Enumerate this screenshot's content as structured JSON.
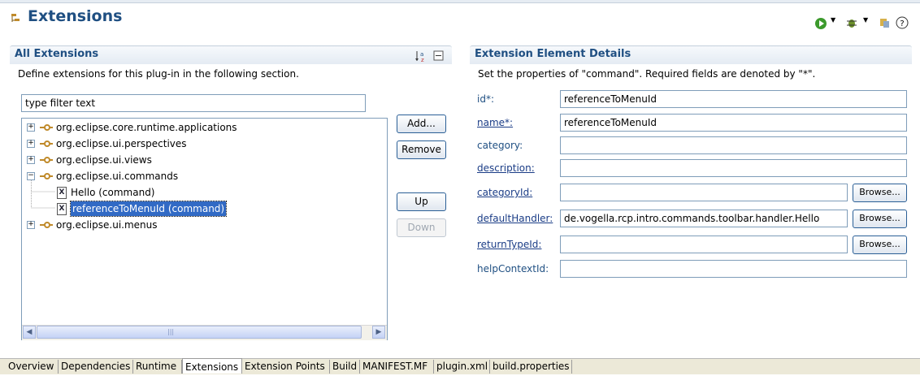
{
  "editor": {
    "title": "Extensions"
  },
  "toolbar_icons": [
    "run-icon",
    "dropdown-arrow-icon",
    "debug-icon",
    "dropdown-arrow-icon",
    "export-icon",
    "help-icon"
  ],
  "left": {
    "title": "All Extensions",
    "description": "Define extensions for this plug-in in the following section.",
    "filter_placeholder": "type filter text",
    "tree": [
      {
        "label": "org.eclipse.core.runtime.applications",
        "expanded": false
      },
      {
        "label": "org.eclipse.ui.perspectives",
        "expanded": false
      },
      {
        "label": "org.eclipse.ui.views",
        "expanded": false
      },
      {
        "label": "org.eclipse.ui.commands",
        "expanded": true
      },
      {
        "label": "Hello (command)",
        "child": true
      },
      {
        "label": "referenceToMenuId (command)",
        "child": true,
        "selected": true
      },
      {
        "label": "org.eclipse.ui.menus",
        "expanded": false
      }
    ],
    "buttons": {
      "add": "Add...",
      "remove": "Remove",
      "up": "Up",
      "down": "Down"
    }
  },
  "right": {
    "title": "Extension Element Details",
    "description": "Set the properties of \"command\". Required fields are denoted by \"*\".",
    "fields": [
      {
        "label": "id*:",
        "value": "referenceToMenuId",
        "link": false
      },
      {
        "label": "name*:",
        "value": "referenceToMenuId",
        "link": true
      },
      {
        "label": "category:",
        "value": "",
        "link": false
      },
      {
        "label": "description:",
        "value": "",
        "link": true
      },
      {
        "label": "categoryId:",
        "value": "",
        "link": true,
        "browse": "Browse..."
      },
      {
        "label": "defaultHandler:",
        "value": "de.vogella.rcp.intro.commands.toolbar.handler.Hello",
        "link": true,
        "browse": "Browse..."
      },
      {
        "label": "returnTypeId:",
        "value": "",
        "link": true,
        "browse": "Browse..."
      },
      {
        "label": "helpContextId:",
        "value": "",
        "link": false
      }
    ]
  },
  "tabs": [
    {
      "label": "Overview"
    },
    {
      "label": "Dependencies"
    },
    {
      "label": "Runtime"
    },
    {
      "label": "Extensions",
      "active": true
    },
    {
      "label": "Extension Points"
    },
    {
      "label": "Build"
    },
    {
      "label": "MANIFEST.MF"
    },
    {
      "label": "plugin.xml"
    },
    {
      "label": "build.properties"
    }
  ],
  "colors": {
    "accent": "#1f4f82",
    "selection": "#316ac5",
    "border": "#7f9db9"
  }
}
